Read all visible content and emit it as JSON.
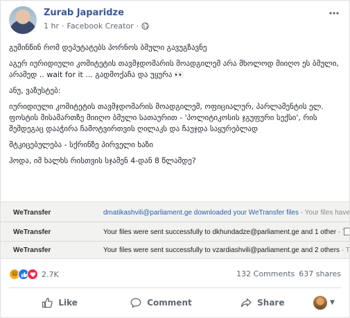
{
  "post": {
    "author": "Zurab Japaridze",
    "time": "1 hr",
    "separator": "·",
    "role": "Facebook Creator",
    "more_label": "···"
  },
  "body": {
    "p1": "გუშინწინ რომ დეპუტატებს პორნოს ბმული გავუგზავნე",
    "p2": "აგერ იურიდიული კომიტეტის თავმჯდომარის მოადგილემ არა მხოლოდ მიიღო ეს ბმული, არამედ .. wait for it ... გადმოქაჩა და უყურა 👀",
    "p3": "ანუ, ვაზუსტებ:",
    "p4": "იურიდიული კომიტეტის თავმჯდომარის მოადგილემ, ოფიციალურ, პარლამენტის ელ. ფოსტის მისამართზე მიიღო ბმული სათაურით - 'პოლიტიკოსის ჯგუფური სექსი', რის შემდეგაც დააჭირა ჩამოტვირთვის ღილაკს და ჩაუჯდა საყურებლად",
    "p5": "მტკიცებულება - სქრინზე პირველი ხაზი",
    "p6": "ჰოდა, იმ ხალხს რისთვის სჯამენ 4-დან 8 წლამდე?"
  },
  "screenshot": {
    "rows": [
      {
        "app": "WeTransfer",
        "msg": "dmatikashvili@parliament.ge downloaded your WeTransfer files",
        "tail": " - Your files have been"
      },
      {
        "app": "WeTransfer",
        "msg": "Your files were sent successfully to dkhundadze@parliament.ge and 1 other",
        "tail": " - Thank"
      },
      {
        "app": "WeTransfer",
        "msg": "Your files were sent successfully to vzardiashvili@parliament.ge and 2 others",
        "tail": " - Than"
      }
    ]
  },
  "stats": {
    "reactions_count": "2.7K",
    "comments": "132 Comments",
    "shares": "637 shares"
  },
  "actions": {
    "like": "Like",
    "comment": "Comment",
    "share": "Share"
  },
  "icons": {
    "globe": "globe-icon",
    "like": "thumbs-up-icon",
    "comment": "speech-bubble-icon",
    "share": "share-arrow-icon"
  },
  "colors": {
    "author": "#385898",
    "like_reaction": "#2078f4",
    "love_reaction": "#f0284a",
    "haha_reaction": "#f7b125"
  }
}
